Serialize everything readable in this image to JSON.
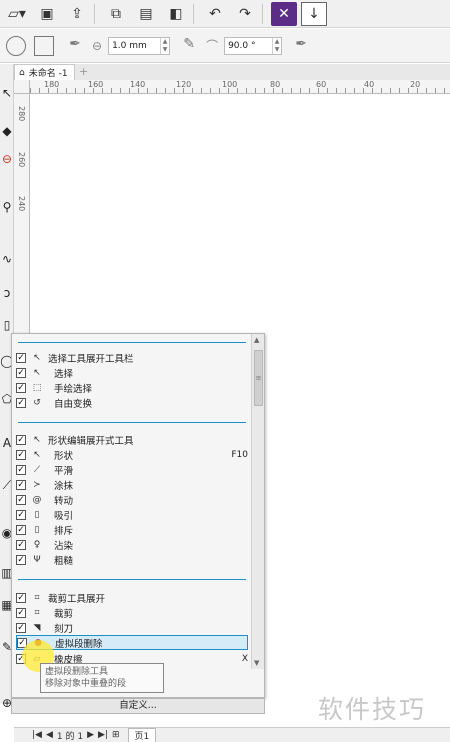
{
  "toolbar_sizes": {
    "outline_width": "1.0 mm",
    "angle": "90.0 °"
  },
  "document": {
    "tab_title": "未命名 -1"
  },
  "ruler": {
    "h_labels": [
      "180",
      "160",
      "140",
      "120",
      "100",
      "80",
      "60",
      "40",
      "20"
    ],
    "v_labels": [
      "280",
      "260",
      "240"
    ]
  },
  "popup": {
    "groups": [
      {
        "title": "选择工具展开工具栏",
        "items": [
          {
            "label": "选择",
            "shortcut": ""
          },
          {
            "label": "手绘选择",
            "shortcut": ""
          },
          {
            "label": "自由变换",
            "shortcut": ""
          }
        ]
      },
      {
        "title": "形状编辑展开式工具",
        "items": [
          {
            "label": "形状",
            "shortcut": "F10"
          },
          {
            "label": "平滑",
            "shortcut": ""
          },
          {
            "label": "涂抹",
            "shortcut": ""
          },
          {
            "label": "转动",
            "shortcut": ""
          },
          {
            "label": "吸引",
            "shortcut": ""
          },
          {
            "label": "排斥",
            "shortcut": ""
          },
          {
            "label": "沾染",
            "shortcut": ""
          },
          {
            "label": "粗糙",
            "shortcut": ""
          }
        ]
      },
      {
        "title": "裁剪工具展开",
        "items": [
          {
            "label": "裁剪",
            "shortcut": ""
          },
          {
            "label": "刻刀",
            "shortcut": ""
          },
          {
            "label": "虚拟段删除",
            "shortcut": ""
          },
          {
            "label": "橡皮擦",
            "shortcut": "X"
          }
        ]
      }
    ],
    "tooltip_line1": "虚拟段删除工具",
    "tooltip_line2": "移除对象中重叠的段",
    "customize_label": "自定义..."
  },
  "pagenav": {
    "page_of": "1 的 1",
    "page_tab": "页1"
  },
  "watermark": "软件技巧"
}
